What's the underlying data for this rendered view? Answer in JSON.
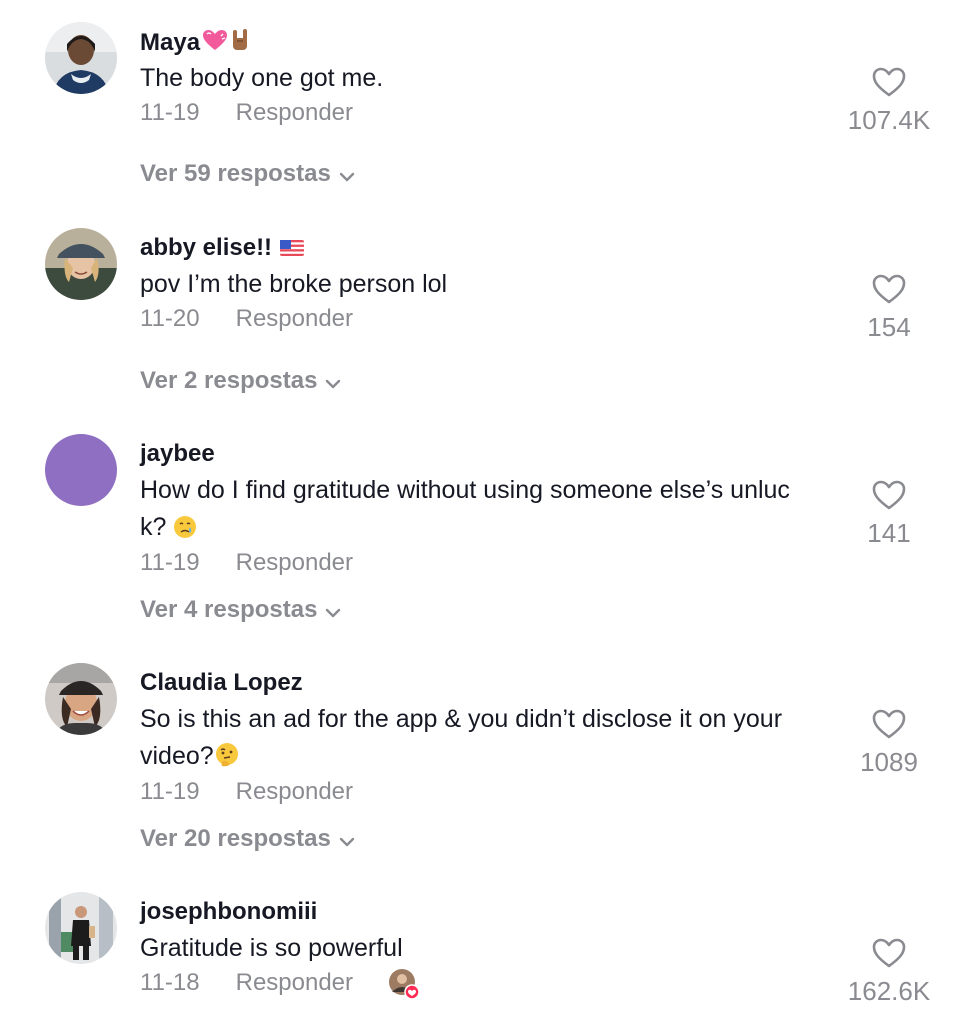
{
  "comments": [
    {
      "username": "Maya",
      "text": "The body one got me.",
      "date": "11-19",
      "reply_label": "Responder",
      "replies": "Ver 59 respostas",
      "likes": "107.4K",
      "avatar_icon": "user-photo",
      "decor": [
        "heart-emoji",
        "rock-hand-emoji"
      ]
    },
    {
      "username": "abby elise!!",
      "text": "pov I’m the broke person lol",
      "date": "11-20",
      "reply_label": "Responder",
      "replies": "Ver 2 respostas",
      "likes": "154",
      "avatar_icon": "user-photo",
      "decor": [
        "us-flag-emoji"
      ]
    },
    {
      "username": "jaybee",
      "text_line1": "How do I find gratitude without using someone else’s unluc",
      "text_line2": "k? ",
      "date": "11-19",
      "reply_label": "Responder",
      "replies": "Ver 4 respostas",
      "likes": "141",
      "avatar_color": "#8e6fc1",
      "decor": [
        "crying-face-emoji"
      ]
    },
    {
      "username": "Claudia Lopez",
      "text_line1": "So is this an ad for the app & you didn’t disclose it on your",
      "text_line2": "video?",
      "date": "11-19",
      "reply_label": "Responder",
      "replies": "Ver 20 respostas",
      "likes": "1089",
      "avatar_icon": "user-photo",
      "decor": [
        "thinking-face-emoji"
      ]
    },
    {
      "username": "josephbonomiii",
      "text": "Gratitude is so powerful",
      "date": "11-18",
      "reply_label": "Responder",
      "likes": "162.6K",
      "avatar_icon": "user-photo",
      "decor": [
        "liked-by-creator-badge"
      ]
    }
  ],
  "colors": {
    "text": "#161823",
    "muted": "#8a8b91",
    "purple_avatar": "#8e6fc1",
    "badge_red": "#fe2c55"
  }
}
